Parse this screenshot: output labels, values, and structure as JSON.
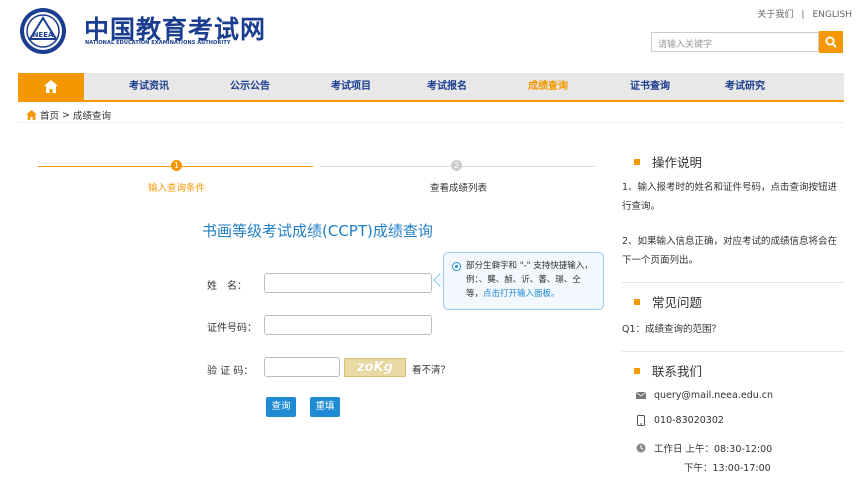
{
  "header": {
    "logo_cn": "中国教育考试网",
    "logo_en": "NATIONAL EDUCATION EXAMINATIONS AUTHORITY",
    "logo_badge": "NEEA",
    "about": "关于我们",
    "separator": "|",
    "english": "ENGLISH",
    "search_placeholder": "请输入关键字"
  },
  "nav": {
    "items": [
      "考试资讯",
      "公示公告",
      "考试项目",
      "考试报名",
      "成绩查询",
      "证书查询",
      "考试研究"
    ],
    "active_index": 4
  },
  "breadcrumb": {
    "home": "首页",
    "sep": ">",
    "current": "成绩查询"
  },
  "steps": [
    {
      "num": "1",
      "label": "输入查询条件"
    },
    {
      "num": "2",
      "label": "查看成绩列表"
    }
  ],
  "form": {
    "title": "书画等级考试成绩(CCPT)成绩查询",
    "name_label": "姓　名：",
    "id_label": "证件号码：",
    "captcha_label": "验 证 码：",
    "captcha_text": "zoKg",
    "captcha_refresh": "看不清？",
    "query_button": "查询",
    "reset_button": "重填"
  },
  "tooltip": {
    "text": "部分生僻字和 \"-\" 支持快捷输入，例：、龑、赪、䜣、萫、璟、仝等，",
    "link": "点击打开输入面板。"
  },
  "sidebar": {
    "instructions_title": "操作说明",
    "instruction_1": "1、输入报考时的姓名和证件号码，点击查询按钮进行查询。",
    "instruction_2": "2、如果输入信息正确，对应考试的成绩信息将会在下一个页面列出。",
    "faq_title": "常见问题",
    "faq_1": "Q1：成绩查询的范围？",
    "contact_title": "联系我们",
    "email": "query@mail.neea.edu.cn",
    "phone": "010-83020302",
    "hours_am": "工作日 上午：08:30-12:00",
    "hours_pm": "下午：13:00-17:00"
  },
  "colors": {
    "accent": "#f39800",
    "brand": "#1b3d8f",
    "link": "#1f8bd4"
  }
}
